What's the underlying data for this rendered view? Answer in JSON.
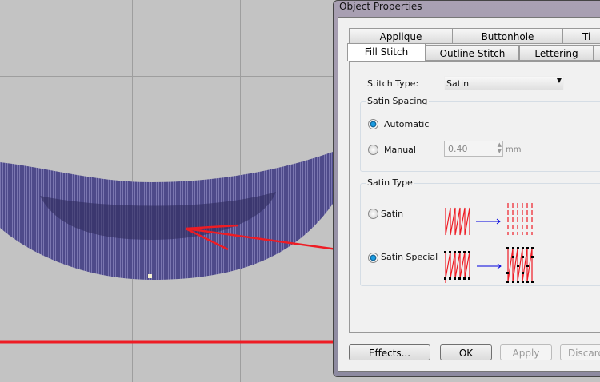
{
  "dialog": {
    "title": "Object Properties",
    "tabs_row1": [
      "Applique",
      "Buttonhole",
      "Ti"
    ],
    "tabs_row2": [
      "Fill Stitch",
      "Outline Stitch",
      "Lettering"
    ],
    "active_tab": "Fill Stitch",
    "stitch_type_label": "Stitch Type:",
    "stitch_type_value": "Satin",
    "satin_spacing": {
      "label": "Satin Spacing",
      "automatic": "Automatic",
      "manual": "Manual",
      "manual_value": "0.40",
      "unit": "mm",
      "selected": "Automatic"
    },
    "satin_type": {
      "label": "Satin Type",
      "satin": "Satin",
      "satin_special": "Satin Special",
      "selected": "Satin Special"
    },
    "buttons": {
      "effects": "Effects...",
      "ok": "OK",
      "apply": "Apply",
      "discard": "Discard"
    }
  },
  "colors": {
    "embroidery": "#4a4580",
    "annotation": "#ee1c24"
  }
}
